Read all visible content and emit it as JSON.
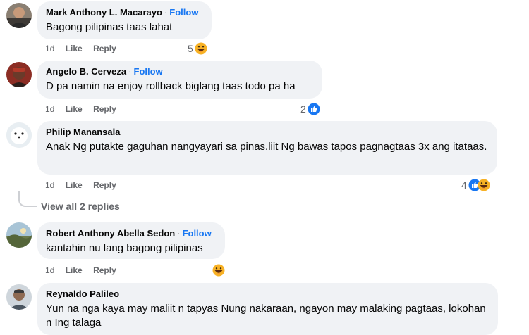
{
  "comments": [
    {
      "name": "Mark Anthony L. Macarayo",
      "follow": "Follow",
      "text": "Bagong pilipinas taas lahat",
      "time": "1d",
      "like": "Like",
      "reply": "Reply",
      "reaction_count": "5",
      "reactions": [
        "haha-icon"
      ]
    },
    {
      "name": "Angelo B. Cerveza",
      "follow": "Follow",
      "text": "D pa namin na enjoy rollback biglang taas todo pa ha",
      "time": "1d",
      "like": "Like",
      "reply": "Reply",
      "reaction_count": "2",
      "reactions": [
        "like-icon"
      ]
    },
    {
      "name": "Philip Manansala",
      "follow": "",
      "text": "Anak Ng putakte gaguhan nangyayari sa pinas.liit Ng bawas tapos pagnagtaas 3x ang itataas.",
      "time": "1d",
      "like": "Like",
      "reply": "Reply",
      "reaction_count": "4",
      "reactions": [
        "like-icon",
        "haha-icon"
      ],
      "view_replies": "View all 2 replies"
    },
    {
      "name": "Robert Anthony Abella Sedon",
      "follow": "Follow",
      "text": "kantahin nu lang bagong pilipinas",
      "time": "1d",
      "like": "Like",
      "reply": "Reply",
      "reaction_count": "",
      "reactions": [
        "haha-icon"
      ]
    },
    {
      "name": "Reynaldo Palileo",
      "follow": "",
      "text": "Yun na nga kaya may maliit n tapyas Nung nakaraan, ngayon may malaking pagtaas, lokohan n Ing talaga",
      "time": "",
      "like": "",
      "reply": "",
      "reaction_count": "",
      "reactions": []
    }
  ],
  "colors": {
    "bubble": "#f0f2f5",
    "link": "#1877f2",
    "secondary": "#65676b"
  }
}
